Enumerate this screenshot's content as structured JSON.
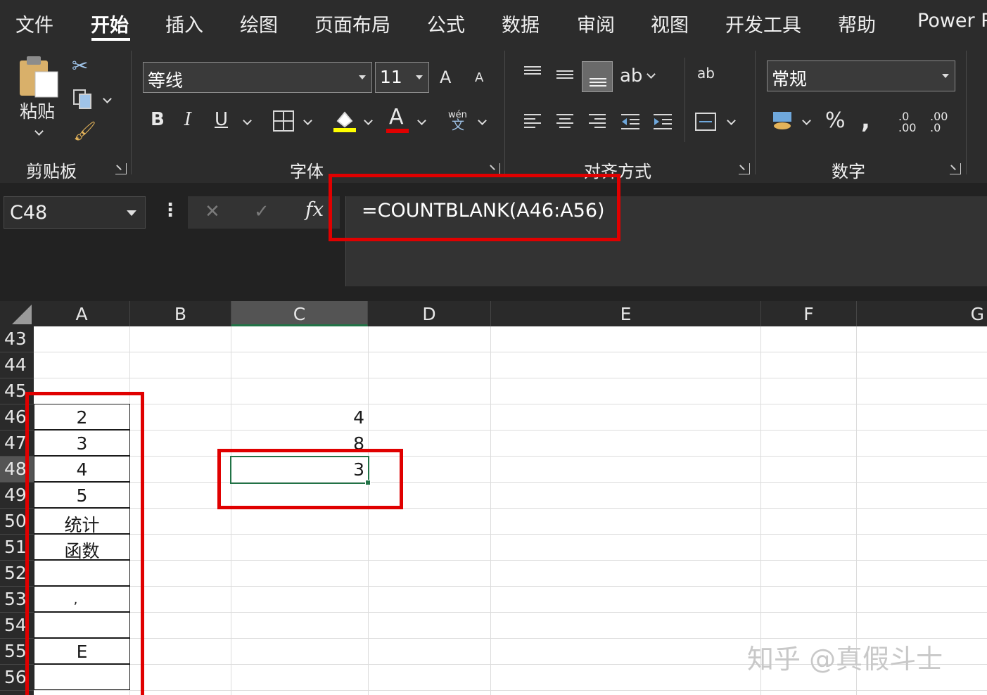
{
  "ribbon_tabs": [
    "文件",
    "开始",
    "插入",
    "绘图",
    "页面布局",
    "公式",
    "数据",
    "审阅",
    "视图",
    "开发工具",
    "帮助",
    "Power P"
  ],
  "active_tab": "开始",
  "clipboard": {
    "paste_label": "粘贴",
    "group_label": "剪贴板"
  },
  "font": {
    "name": "等线",
    "size": "11",
    "group_label": "字体",
    "bold": "B",
    "italic": "I",
    "underline": "U",
    "font_color_glyph": "A",
    "phonetic_top": "wén",
    "phonetic_bottom": "文",
    "grow": "A",
    "shrink": "A"
  },
  "alignment": {
    "group_label": "对齐方式"
  },
  "number": {
    "format": "常规",
    "group_label": "数字",
    "percent": "%",
    "comma": ",",
    "inc_decimal": ".0 .00",
    "dec_decimal": ".00 .0"
  },
  "formula_bar": {
    "name_box": "C48",
    "formula": "=COUNTBLANK(A46:A56)",
    "cancel": "✕",
    "enter": "✓",
    "fx": "fx"
  },
  "columns": [
    "A",
    "B",
    "C",
    "D",
    "E",
    "F",
    "G"
  ],
  "active_column": "C",
  "rows": [
    "43",
    "44",
    "45",
    "46",
    "47",
    "48",
    "49",
    "50",
    "51",
    "52",
    "53",
    "54",
    "55",
    "56"
  ],
  "active_row": "48",
  "column_a_values": [
    "2",
    "3",
    "4",
    "5",
    "统计",
    "函数",
    "",
    ",",
    "",
    "E",
    ""
  ],
  "column_c_values": [
    "4",
    "8",
    "3"
  ],
  "colors": {
    "ribbon_bg": "#2c2c2c",
    "accent_green": "#217346",
    "highlight_red": "#e00000"
  },
  "watermark": "知乎 @真假斗士"
}
